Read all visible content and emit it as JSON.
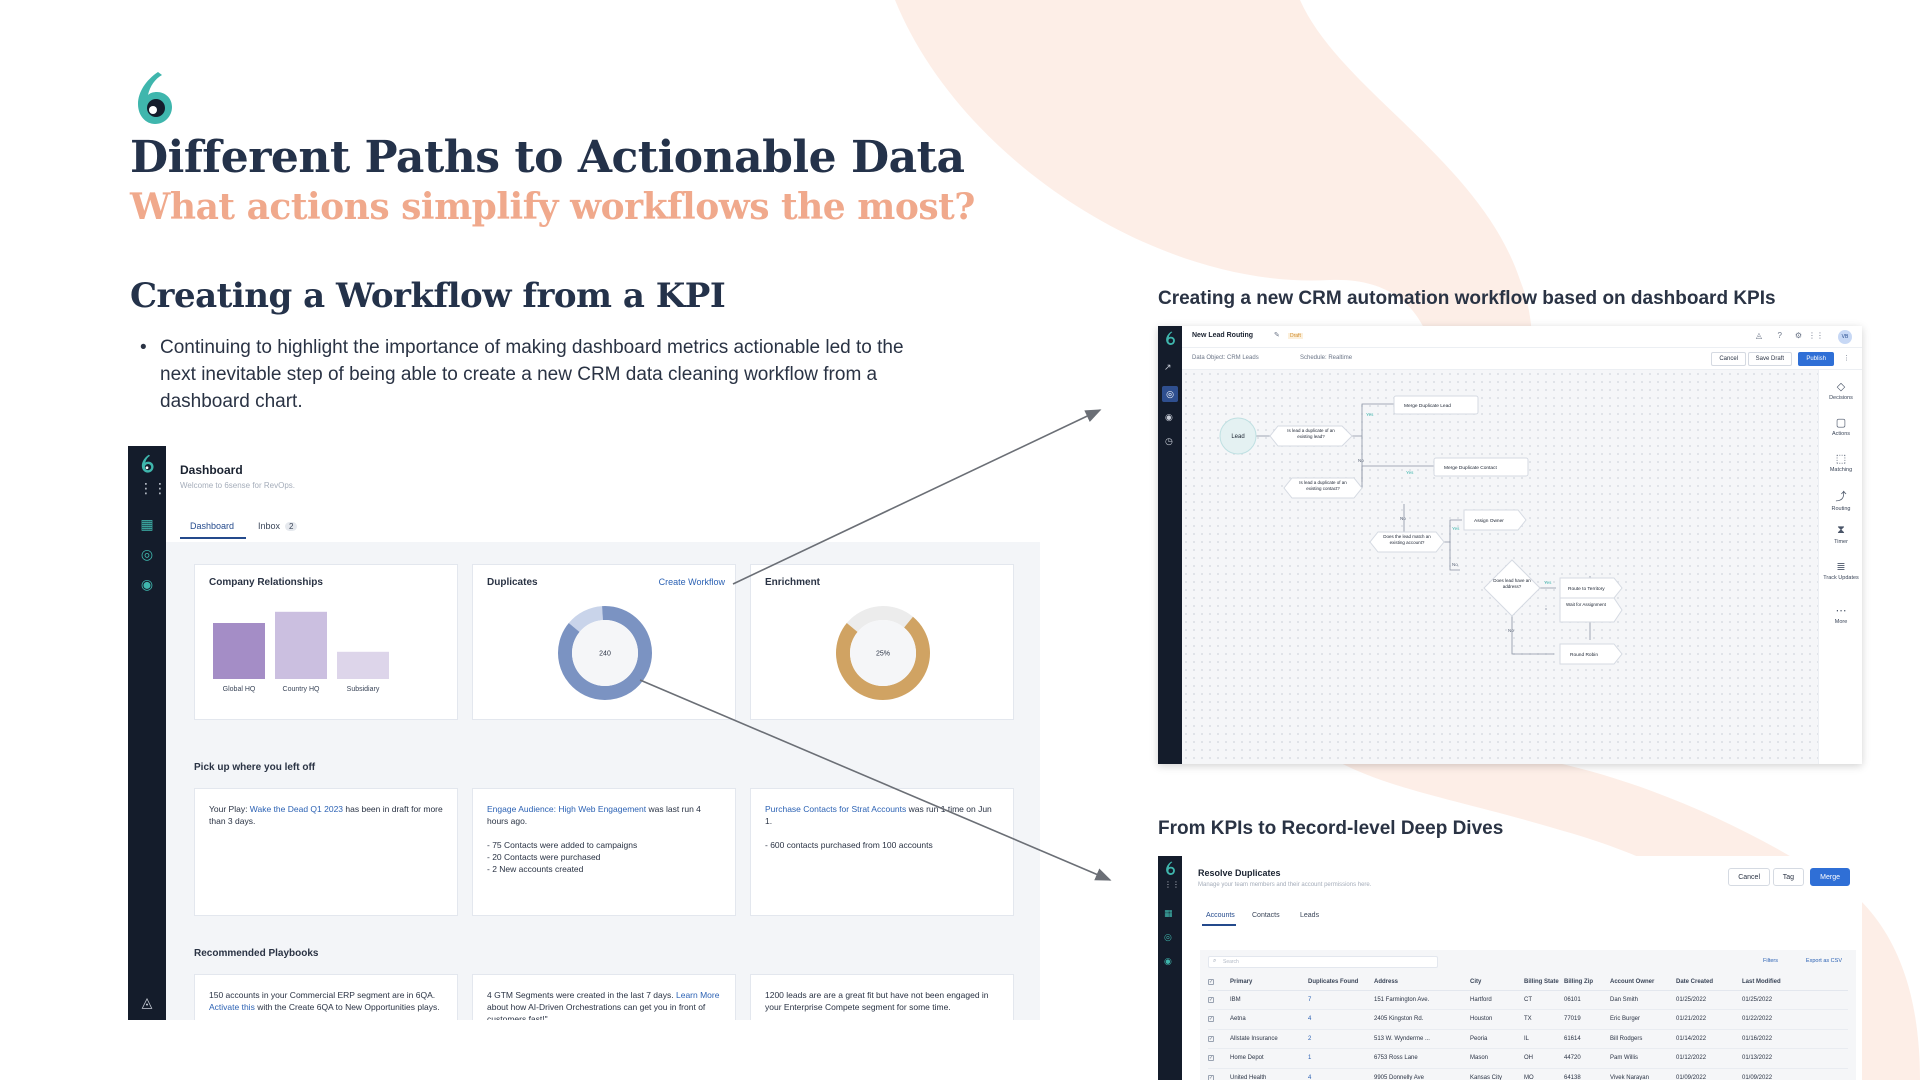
{
  "slide": {
    "title": "Different Paths to Actionable Data",
    "subtitle": "What actions simplify workflows the most?",
    "section_heading": "Creating a Workflow from a KPI",
    "bullet": "Continuing to highlight the importance of making dashboard metrics actionable led to the next inevitable step of being able to create a new CRM data cleaning workflow from a dashboard chart.",
    "right_heading_top": "Creating a new CRM automation workflow based on dashboard KPIs",
    "right_heading_bottom": "From KPIs to Record-level Deep Dives",
    "colors": {
      "title": "#24324a",
      "subtitle_accent": "#f0a98c",
      "background_curve": "#fdeee7",
      "rail": "#141c2b",
      "brand_teal": "#3fb6ad"
    }
  },
  "dashboard": {
    "title": "Dashboard",
    "welcome": "Welcome to 6sense for RevOps.",
    "tabs": {
      "dashboard": "Dashboard",
      "inbox": "Inbox",
      "inbox_count": "2"
    },
    "cards": {
      "company_relationships": {
        "title": "Company Relationships"
      },
      "duplicates": {
        "title": "Duplicates",
        "link": "Create Workflow",
        "center_value": "240"
      },
      "enrichment": {
        "title": "Enrichment",
        "center_value": "25%"
      }
    },
    "pick_up": {
      "label": "Pick up where you left off",
      "card1": {
        "prefix": "Your Play: ",
        "link": "Wake the Dead Q1 2023",
        "rest": " has been in draft for more than 3 days."
      },
      "card2": {
        "link": "Engage Audience: High Web Engagement",
        "rest": " was last run 4 hours ago.",
        "l1": "- 75 Contacts were added to campaigns",
        "l2": "- 20 Contacts were purchased",
        "l3": "- 2 New accounts created"
      },
      "card3": {
        "link": "Purchase Contacts for Strat Accounts",
        "rest": " was run 1 time on Jun 1.",
        "l1": "- 600 contacts purchased from 100 accounts"
      }
    },
    "playbooks": {
      "label": "Recommended Playbooks",
      "card1": {
        "prefix": "150 accounts in your Commercial ERP segment are in 6QA. ",
        "link": "Activate this",
        "rest": " with the Create 6QA to New Opportunities plays."
      },
      "card2": {
        "prefix": "4 GTM Segments were created in the last 7 days. ",
        "link": "Learn More",
        "rest": " about how AI-Driven Orchestrations can get you in front of customers fast!\""
      },
      "card3": {
        "text": "1200 leads are are a great fit but have not been engaged in your Enterprise Compete segment for some time."
      }
    }
  },
  "chart_data": {
    "type": "bar",
    "categories": [
      "Global HQ",
      "Country HQ",
      "Subsidiary"
    ],
    "values": [
      35,
      42,
      17
    ],
    "ylim": [
      0,
      50
    ],
    "grid": false,
    "colors": [
      "#a48dc6",
      "#cbbfe0",
      "#ddd5ea"
    ]
  },
  "donuts": {
    "duplicates": {
      "value": 240,
      "share": 0.13,
      "main_color": "#7b93c2",
      "rest_color": "#c9d4ea"
    },
    "enrichment": {
      "value": 25,
      "share": 0.25,
      "main_color": "#d0a363",
      "rest_color": "#ececec"
    }
  },
  "workflow": {
    "name": "New Lead Routing",
    "status": "Draft",
    "data_object": "Data Object: CRM Leads",
    "schedule": "Schedule: Realtime",
    "buttons": {
      "cancel": "Cancel",
      "save": "Save Draft",
      "publish": "Publish"
    },
    "avatar": "VB",
    "nodes": {
      "lead": "Lead",
      "q1": "Is lead a duplicate of an existing lead?",
      "merge_lead": "Merge Duplicate Lead",
      "q2": "Is lead a duplicate of an existing contact?",
      "merge_contact": "Merge Duplicate Contact",
      "q3": "Does the lead match an existing account?",
      "assign_owner": "Assign Owner",
      "q4": "Does lead have an address?",
      "route_territory": "Route to Territory",
      "wait": "Wait for Assignment",
      "round_robin": "Round Robin"
    },
    "edge_labels": {
      "yes": "Yes",
      "no": "No"
    },
    "sidebar": [
      "Decisions",
      "Actions",
      "Matching",
      "Routing",
      "Timer",
      "Track Updates",
      "More"
    ]
  },
  "resolve": {
    "title": "Resolve Duplicates",
    "description": "Manage your team members and their account permissions here.",
    "buttons": {
      "cancel": "Cancel",
      "tag": "Tag",
      "merge": "Merge"
    },
    "tabs": [
      "Accounts",
      "Contacts",
      "Leads"
    ],
    "search_placeholder": "Search",
    "filters": "Filters",
    "export": "Export as CSV",
    "columns": [
      "Primary",
      "Duplicates Found",
      "Address",
      "City",
      "Billing State",
      "Billing Zip",
      "Account Owner",
      "Date Created",
      "Last Modified"
    ],
    "rows": [
      [
        "IBM",
        "7",
        "151 Farmington Ave.",
        "Hartford",
        "CT",
        "06101",
        "Dan Smith",
        "01/25/2022",
        "01/25/2022"
      ],
      [
        "Aetna",
        "4",
        "2405 Kingston Rd.",
        "Houston",
        "TX",
        "77019",
        "Eric Burger",
        "01/21/2022",
        "01/22/2022"
      ],
      [
        "Allstate Insurance",
        "2",
        "513 W. Wynderme ...",
        "Peoria",
        "IL",
        "61614",
        "Bill Rodgers",
        "01/14/2022",
        "01/16/2022"
      ],
      [
        "Home Depot",
        "1",
        "6753 Ross Lane",
        "Mason",
        "OH",
        "44720",
        "Pam Willis",
        "01/12/2022",
        "01/13/2022"
      ],
      [
        "United Health",
        "4",
        "9905 Donnelly Ave",
        "Kansas City",
        "MO",
        "64138",
        "Vivek Narayan",
        "01/09/2022",
        "01/09/2022"
      ]
    ]
  }
}
